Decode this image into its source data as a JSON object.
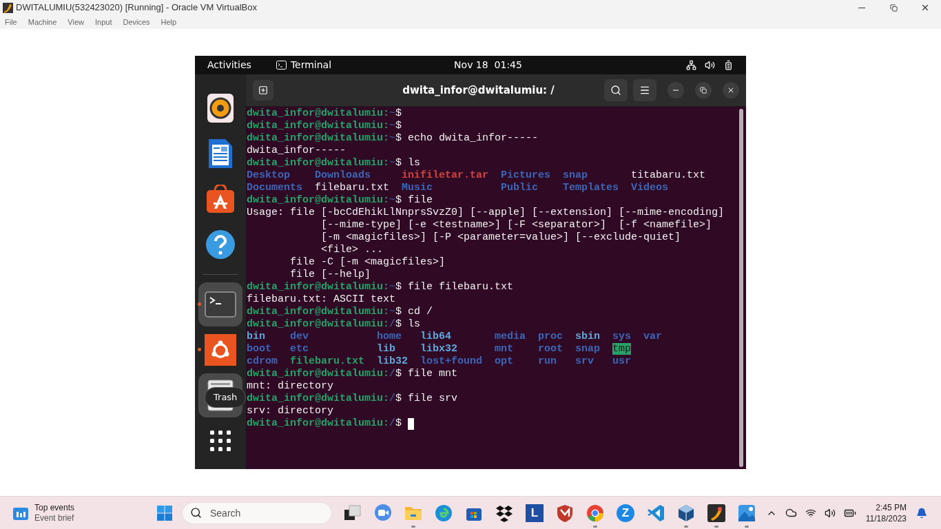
{
  "window": {
    "title": "DWITALUMIU(532423020) [Running] - Oracle VM VirtualBox",
    "menu": [
      "File",
      "Machine",
      "View",
      "Input",
      "Devices",
      "Help"
    ]
  },
  "vm": {
    "topbar": {
      "activities": "Activities",
      "app": "Terminal",
      "clock": "Nov 18  01:45"
    },
    "dock": [
      {
        "kind": "speaker",
        "running": false,
        "selected": false
      },
      {
        "kind": "writer",
        "running": false,
        "selected": false
      },
      {
        "kind": "store",
        "running": false,
        "selected": false
      },
      {
        "kind": "help",
        "running": false,
        "selected": false
      },
      {
        "kind": "separator"
      },
      {
        "kind": "terminal",
        "running": true,
        "selected": true
      },
      {
        "kind": "ubuntu",
        "running": true,
        "selected": false
      },
      {
        "kind": "trash",
        "running": false,
        "selected": true
      },
      {
        "kind": "grid",
        "running": false,
        "selected": false
      }
    ],
    "tooltip": "Trash",
    "terminal": {
      "title": "dwita_infor@dwitalumiu: /",
      "lines": [
        {
          "kind": "prompt",
          "user": "dwita_infor@dwitalumiu:",
          "path": "~",
          "text": "$"
        },
        {
          "kind": "prompt",
          "user": "dwita_infor@dwitalumiu:",
          "path": "~",
          "text": "$"
        },
        {
          "kind": "prompt",
          "user": "dwita_infor@dwitalumiu:",
          "path": "~",
          "text": "$ echo dwita_infor-----"
        },
        {
          "kind": "output",
          "text": "dwita_infor-----"
        },
        {
          "kind": "prompt",
          "user": "dwita_infor@dwitalumiu:",
          "path": "~",
          "text": "$ ls"
        },
        {
          "kind": "ls",
          "cells": [
            {
              "text": "Desktop",
              "kind": "dir"
            },
            {
              "text": "Downloads",
              "kind": "dir"
            },
            {
              "text": "inifiletar.tar",
              "kind": "archive"
            },
            {
              "text": "Pictures",
              "kind": "dir"
            },
            {
              "text": "snap",
              "kind": "dir"
            },
            {
              "text": "titabaru.txt",
              "kind": "file"
            }
          ]
        },
        {
          "kind": "ls",
          "cells": [
            {
              "text": "Documents",
              "kind": "dir"
            },
            {
              "text": "filebaru.txt",
              "kind": "file"
            },
            {
              "text": "Music",
              "kind": "dir"
            },
            {
              "text": "Public",
              "kind": "dir"
            },
            {
              "text": "Templates",
              "kind": "dir"
            },
            {
              "text": "Videos",
              "kind": "dir"
            }
          ]
        },
        {
          "kind": "prompt",
          "user": "dwita_infor@dwitalumiu:",
          "path": "~",
          "text": "$ file"
        },
        {
          "kind": "output",
          "text": "Usage: file [-bcCdEhikLlNnprsSvzZ0] [--apple] [--extension] [--mime-encoding]"
        },
        {
          "kind": "output",
          "text": "            [--mime-type] [-e <testname>] [-F <separator>]  [-f <namefile>]"
        },
        {
          "kind": "output",
          "text": "            [-m <magicfiles>] [-P <parameter=value>] [--exclude-quiet]"
        },
        {
          "kind": "output",
          "text": "            <file> ..."
        },
        {
          "kind": "output",
          "text": "       file -C [-m <magicfiles>]"
        },
        {
          "kind": "output",
          "text": "       file [--help]"
        },
        {
          "kind": "prompt",
          "user": "dwita_infor@dwitalumiu:",
          "path": "~",
          "text": "$ file filebaru.txt"
        },
        {
          "kind": "output",
          "text": "filebaru.txt: ASCII text"
        },
        {
          "kind": "prompt",
          "user": "dwita_infor@dwitalumiu:",
          "path": "~",
          "text": "$ cd /"
        },
        {
          "kind": "prompt",
          "user": "dwita_infor@dwitalumiu:",
          "path": "/",
          "text": "$ ls"
        },
        {
          "kind": "ls",
          "cells": [
            {
              "text": "bin",
              "kind": "link"
            },
            {
              "text": "dev",
              "kind": "dir"
            },
            {
              "text": "home",
              "kind": "dir"
            },
            {
              "text": "lib64",
              "kind": "link"
            },
            {
              "text": "media",
              "kind": "dir"
            },
            {
              "text": "proc",
              "kind": "dir"
            },
            {
              "text": "sbin",
              "kind": "link"
            },
            {
              "text": "sys",
              "kind": "dir"
            },
            {
              "text": "var",
              "kind": "dir"
            }
          ]
        },
        {
          "kind": "ls",
          "cells": [
            {
              "text": "boot",
              "kind": "dir"
            },
            {
              "text": "etc",
              "kind": "dir"
            },
            {
              "text": "lib",
              "kind": "link"
            },
            {
              "text": "libx32",
              "kind": "link"
            },
            {
              "text": "mnt",
              "kind": "dir"
            },
            {
              "text": "root",
              "kind": "dir"
            },
            {
              "text": "snap",
              "kind": "dir"
            },
            {
              "text": "tmp",
              "kind": "sticky"
            }
          ]
        },
        {
          "kind": "ls",
          "cells": [
            {
              "text": "cdrom",
              "kind": "dir"
            },
            {
              "text": "filebaru.txt",
              "kind": "exec"
            },
            {
              "text": "lib32",
              "kind": "link"
            },
            {
              "text": "lost+found",
              "kind": "dir"
            },
            {
              "text": "opt",
              "kind": "dir"
            },
            {
              "text": "run",
              "kind": "dir"
            },
            {
              "text": "srv",
              "kind": "dir"
            },
            {
              "text": "usr",
              "kind": "dir"
            }
          ]
        },
        {
          "kind": "prompt",
          "user": "dwita_infor@dwitalumiu:",
          "path": "/",
          "text": "$ file mnt"
        },
        {
          "kind": "output",
          "text": "mnt: directory"
        },
        {
          "kind": "prompt",
          "user": "dwita_infor@dwitalumiu:",
          "path": "/",
          "text": "$ file srv"
        },
        {
          "kind": "output",
          "text": "srv: directory"
        },
        {
          "kind": "prompt",
          "user": "dwita_infor@dwitalumiu:",
          "path": "/",
          "text": "$",
          "cursor": true
        }
      ]
    }
  },
  "taskbar": {
    "widget": {
      "title": "Top events",
      "subtitle": "Event brief"
    },
    "search": {
      "placeholder": "Search"
    },
    "apps": [
      {
        "kind": "taskview",
        "running": false
      },
      {
        "kind": "meet",
        "running": false
      },
      {
        "kind": "folder",
        "running": true
      },
      {
        "kind": "edge",
        "running": false
      },
      {
        "kind": "store",
        "running": false
      },
      {
        "kind": "dropbox",
        "running": false
      },
      {
        "kind": "letter",
        "label": "L",
        "running": false
      },
      {
        "kind": "shield",
        "running": false
      },
      {
        "kind": "chrome",
        "running": true
      },
      {
        "kind": "zcircle",
        "label": "Z",
        "running": false
      },
      {
        "kind": "vscode",
        "running": false
      },
      {
        "kind": "cube",
        "running": true
      },
      {
        "kind": "orange",
        "running": true
      },
      {
        "kind": "photos",
        "running": true
      }
    ],
    "time": "2:45 PM",
    "date": "11/18/2023"
  }
}
